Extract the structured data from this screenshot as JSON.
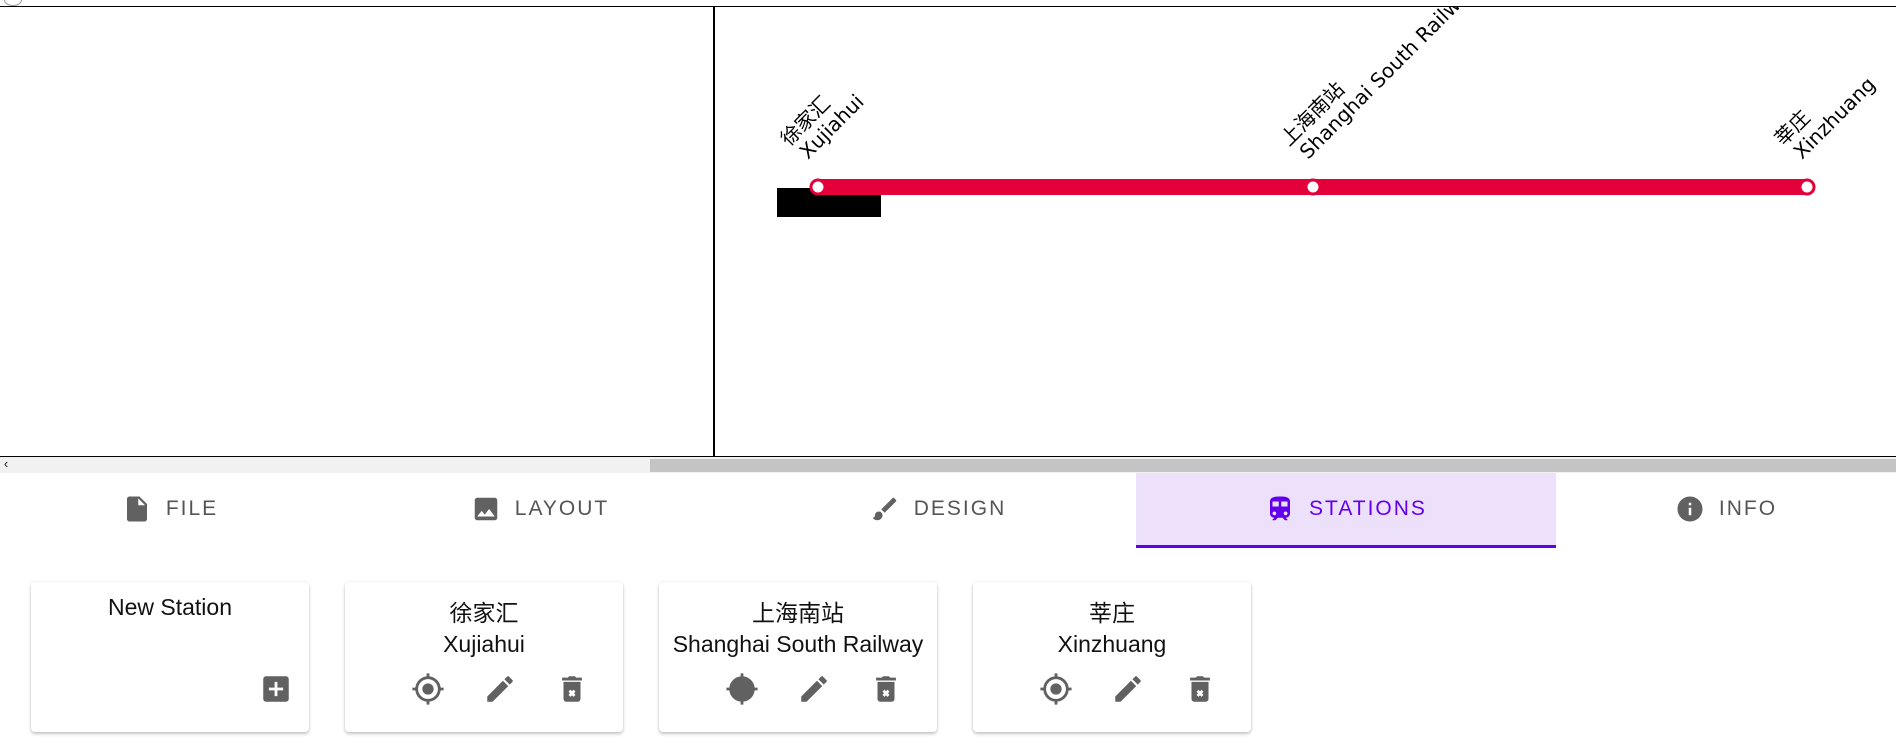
{
  "canvas": {
    "line_color": "#e4003a",
    "stations": [
      {
        "zh": "徐家汇",
        "en": "Xujiahui"
      },
      {
        "zh": "上海南站",
        "en": "Shanghai South Railway"
      },
      {
        "zh": "莘庄",
        "en": "Xinzhuang"
      }
    ]
  },
  "scrollbar": {
    "arrow": "‹"
  },
  "tabs": [
    {
      "label": "FILE",
      "icon": "file-icon"
    },
    {
      "label": "LAYOUT",
      "icon": "image-icon"
    },
    {
      "label": "DESIGN",
      "icon": "brush-icon"
    },
    {
      "label": "STATIONS",
      "icon": "train-icon",
      "active": true
    },
    {
      "label": "INFO",
      "icon": "info-icon"
    }
  ],
  "cards": {
    "new_station": {
      "label": "New Station",
      "icon": "add-box-icon"
    },
    "stations": [
      {
        "zh": "徐家汇",
        "en": "Xujiahui"
      },
      {
        "zh": "上海南站",
        "en": "Shanghai South Railway"
      },
      {
        "zh": "莘庄",
        "en": "Xinzhuang"
      }
    ],
    "action_icons": [
      "locate-icon",
      "edit-icon",
      "delete-icon"
    ]
  },
  "colors": {
    "accent": "#6200ee",
    "active_tab_bg": "#ede0fb",
    "icon_gray": "#616161"
  }
}
